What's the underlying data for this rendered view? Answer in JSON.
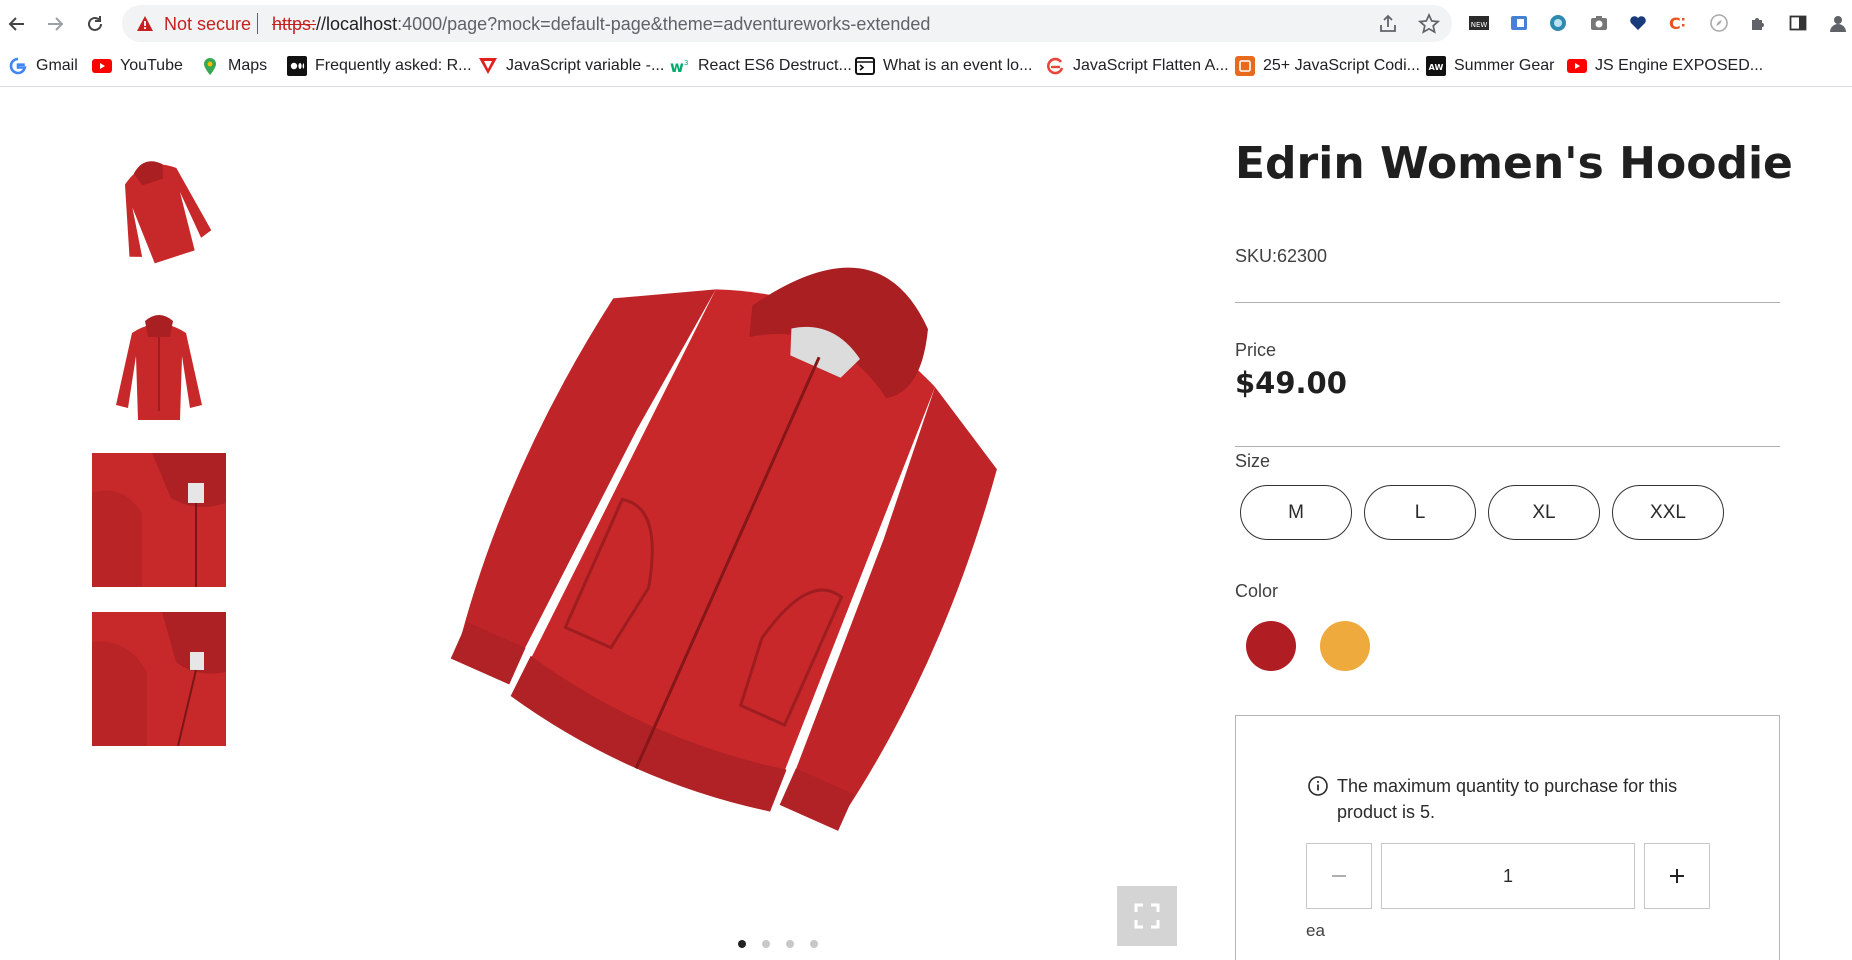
{
  "browser": {
    "security_label": "Not secure",
    "url_scheme": "https:",
    "url_host": "//localhost",
    "url_rest": ":4000/page?mock=default-page&theme=adventureworks-extended",
    "bookmarks": [
      {
        "label": "Gmail",
        "icon": "gmail-icon"
      },
      {
        "label": "YouTube",
        "icon": "youtube-icon"
      },
      {
        "label": "Maps",
        "icon": "maps-icon"
      },
      {
        "label": "Frequently asked: R...",
        "icon": "medium-icon"
      },
      {
        "label": "JavaScript variable -...",
        "icon": "triangle-logo-icon"
      },
      {
        "label": "React ES6 Destruct...",
        "icon": "w3schools-icon"
      },
      {
        "label": "What is an event lo...",
        "icon": "terminal-icon"
      },
      {
        "label": "JavaScript Flatten A...",
        "icon": "educative-icon"
      },
      {
        "label": "25+ JavaScript Codi...",
        "icon": "orange-box-icon"
      },
      {
        "label": "Summer Gear",
        "icon": "aw-icon"
      },
      {
        "label": "JS Engine EXPOSED...",
        "icon": "youtube-icon"
      }
    ]
  },
  "product": {
    "title": "Edrin Women's Hoodie",
    "sku": "SKU:62300",
    "price_label": "Price",
    "price": "$49.00",
    "size_label": "Size",
    "sizes": [
      "M",
      "L",
      "XL",
      "XXL"
    ],
    "color_label": "Color",
    "colors": [
      "#b01e24",
      "#eeaa3c"
    ],
    "max_qty_note": "The maximum quantity to purchase for this product is 5.",
    "quantity": "1",
    "unit": "ea",
    "main_image": "red-zip-hoodie",
    "thumbnail_count": 4,
    "carousel_pages": 4,
    "carousel_active": 1
  }
}
